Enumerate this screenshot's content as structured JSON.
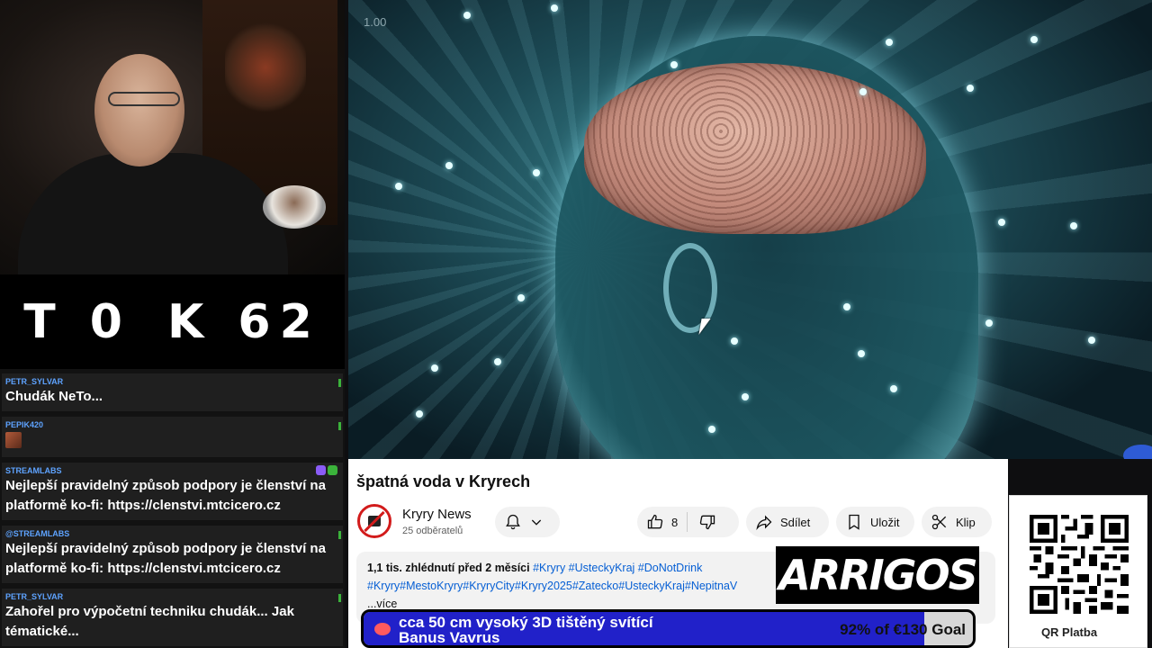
{
  "counter": {
    "left": "T 0",
    "right": "K 62"
  },
  "chat": {
    "messages": [
      {
        "author": "PETR_SYLVAR",
        "text": "Chudák NeTo..."
      },
      {
        "author": "PEPIK420",
        "text": ""
      },
      {
        "author": "STREAMLABS",
        "text": "Nejlepší pravidelný způsob podpory je členství na platformě ko-fi: https://clenstvi.mtcicero.cz"
      },
      {
        "author": "@STREAMLABS",
        "text": "Nejlepší pravidelný způsob podpory je členství na platformě ko-fi: https://clenstvi.mtcicero.cz"
      },
      {
        "author": "PETR_SYLVAR",
        "text": "Zahořel pro výpočetní techniku chudák... Jak tématické..."
      }
    ]
  },
  "video": {
    "speed": "1.00"
  },
  "youtube": {
    "title": "špatná voda v Kryrech",
    "channel_name": "Kryry News",
    "subscribers": "25 odběratelů",
    "likes": "8",
    "share_label": "Sdílet",
    "save_label": "Uložit",
    "clip_label": "Klip",
    "views_date": "1,1 tis. zhlédnutí  před 2 měsíci",
    "tags_line1": "#Kryry #UsteckyKraj #DoNotDrink",
    "tags_line2": "#Kryry#MestoKryry#KryryCity#Kryry2025#Zatecko#UsteckyKraj#NepitnaV",
    "more_label": "...více"
  },
  "logo": {
    "text": "ARRIGOS"
  },
  "qr": {
    "label": "QR Platba"
  },
  "goal": {
    "line1": "cca 50 cm vysoký 3D tištěný svítící",
    "line2": "Banus Vavrus",
    "progress_text": "92% of €130 Goal",
    "progress_fraction": 0.92,
    "fill_color": "#2121c9"
  },
  "colors": {
    "accent_blue": "#065fd4",
    "chat_author": "#5ea3ff"
  }
}
